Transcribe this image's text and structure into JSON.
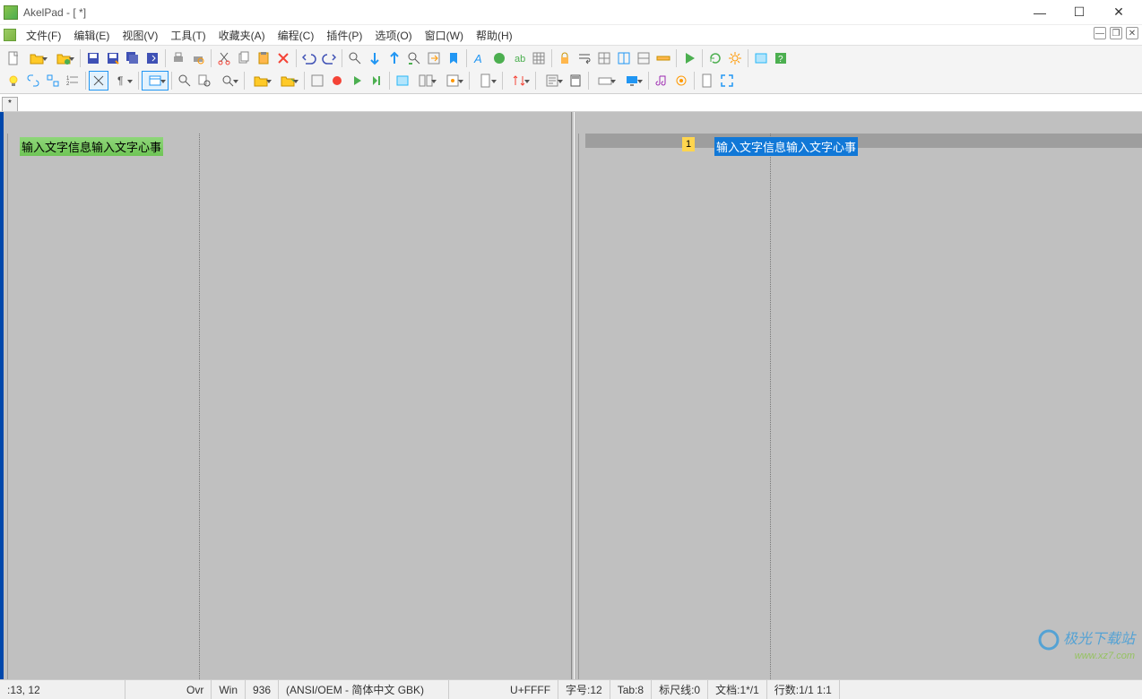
{
  "window": {
    "title": "AkelPad - [ *]"
  },
  "menu": {
    "file": "文件(F)",
    "edit": "编辑(E)",
    "view": "视图(V)",
    "tool": "工具(T)",
    "fav": "收藏夹(A)",
    "macro": "编程(C)",
    "plugin": "插件(P)",
    "option": "选项(O)",
    "window": "窗口(W)",
    "help": "帮助(H)"
  },
  "tabs": {
    "tab1": "*"
  },
  "editor": {
    "left_text": "输入文字信息输入文字心事",
    "right_text": "输入文字信息输入文字心事",
    "right_line_num": "1"
  },
  "status": {
    "pos": ":13, 12",
    "ovr": "Ovr",
    "win": "Win",
    "cp": "936",
    "enc": "(ANSI/OEM - 简体中文 GBK)",
    "unicode": "U+FFFF",
    "font": "字号:12",
    "tab": "Tab:8",
    "ruler": "标尺线:0",
    "docs": "文档:1*/1",
    "lines": "行数:1/1 1:1"
  },
  "watermark": {
    "title": "极光下载站",
    "sub": "www.xz7.com"
  }
}
